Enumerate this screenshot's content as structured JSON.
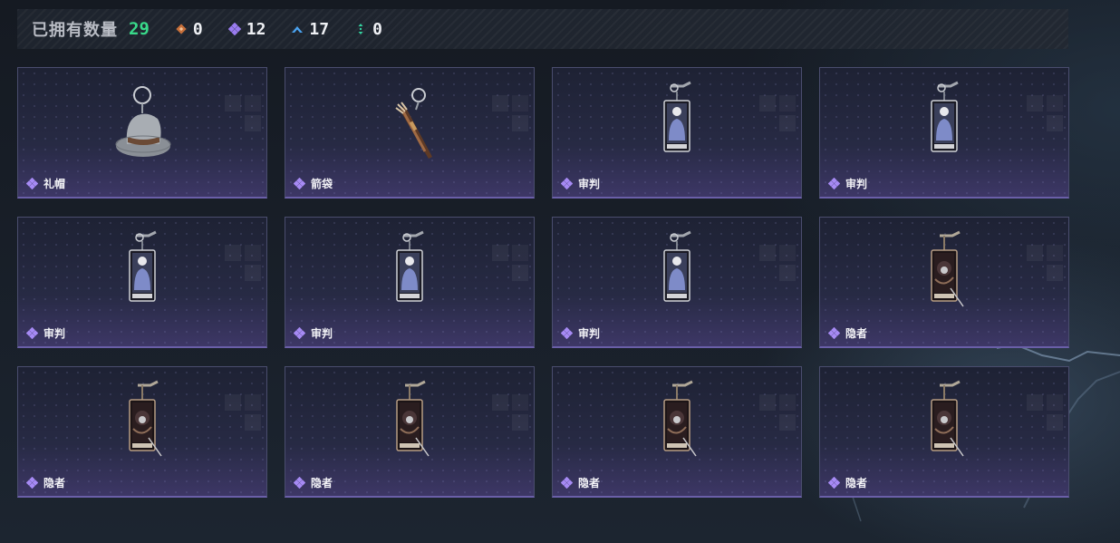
{
  "header": {
    "owned_label": "已拥有数量",
    "owned_count": "29",
    "stats": [
      {
        "icon": "orange-diamond-icon",
        "color": "#c8703a",
        "value": "0"
      },
      {
        "icon": "purple-diamond-icon",
        "color": "#9a7cf0",
        "value": "12"
      },
      {
        "icon": "blue-chevron-icon",
        "color": "#4aa3f0",
        "value": "17"
      },
      {
        "icon": "green-dots-icon",
        "color": "#34d3a0",
        "value": "0"
      }
    ]
  },
  "items": [
    {
      "name": "礼帽",
      "art": "top-hat",
      "rarity": "purple-diamond-icon"
    },
    {
      "name": "箭袋",
      "art": "quiver",
      "rarity": "purple-diamond-icon"
    },
    {
      "name": "审判",
      "art": "judgment-card",
      "rarity": "purple-diamond-icon"
    },
    {
      "name": "审判",
      "art": "judgment-card",
      "rarity": "purple-diamond-icon"
    },
    {
      "name": "审判",
      "art": "judgment-card",
      "rarity": "purple-diamond-icon"
    },
    {
      "name": "审判",
      "art": "judgment-card",
      "rarity": "purple-diamond-icon"
    },
    {
      "name": "审判",
      "art": "judgment-card",
      "rarity": "purple-diamond-icon"
    },
    {
      "name": "隐者",
      "art": "hermit-card",
      "rarity": "purple-diamond-icon"
    },
    {
      "name": "隐者",
      "art": "hermit-card",
      "rarity": "purple-diamond-icon"
    },
    {
      "name": "隐者",
      "art": "hermit-card",
      "rarity": "purple-diamond-icon"
    },
    {
      "name": "隐者",
      "art": "hermit-card",
      "rarity": "purple-diamond-icon"
    },
    {
      "name": "隐者",
      "art": "hermit-card",
      "rarity": "purple-diamond-icon"
    }
  ]
}
